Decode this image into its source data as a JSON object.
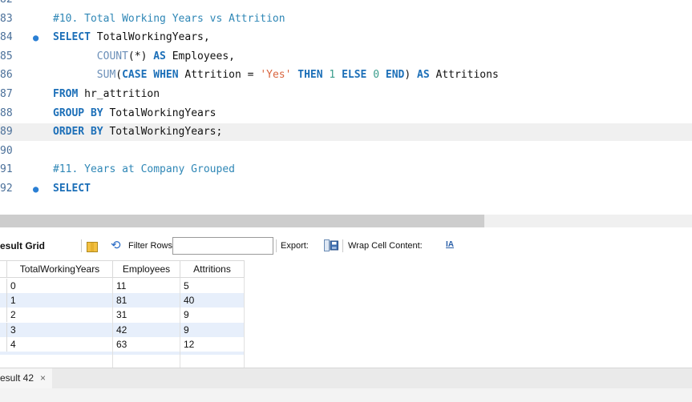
{
  "editor": {
    "lines": [
      {
        "num": "82",
        "dot": false,
        "current": false,
        "tokens": []
      },
      {
        "num": "83",
        "dot": false,
        "current": false,
        "tokens": [
          {
            "t": "#10. Total Working Years vs Attrition",
            "c": "cm"
          }
        ]
      },
      {
        "num": "84",
        "dot": true,
        "current": false,
        "tokens": [
          {
            "t": "SELECT",
            "c": "kw"
          },
          {
            "t": " TotalWorkingYears,",
            "c": "id"
          }
        ]
      },
      {
        "num": "85",
        "dot": false,
        "current": false,
        "tokens": [
          {
            "t": "       COUNT",
            "c": "fn"
          },
          {
            "t": "(*) ",
            "c": "id"
          },
          {
            "t": "AS",
            "c": "kw"
          },
          {
            "t": " Employees,",
            "c": "id"
          }
        ]
      },
      {
        "num": "86",
        "dot": false,
        "current": false,
        "tokens": [
          {
            "t": "       SUM",
            "c": "fn"
          },
          {
            "t": "(",
            "c": "id"
          },
          {
            "t": "CASE WHEN",
            "c": "kw"
          },
          {
            "t": " Attrition = ",
            "c": "id"
          },
          {
            "t": "'Yes'",
            "c": "str"
          },
          {
            "t": " ",
            "c": "id"
          },
          {
            "t": "THEN",
            "c": "kw"
          },
          {
            "t": " ",
            "c": "id"
          },
          {
            "t": "1",
            "c": "num"
          },
          {
            "t": " ",
            "c": "id"
          },
          {
            "t": "ELSE",
            "c": "kw"
          },
          {
            "t": " ",
            "c": "id"
          },
          {
            "t": "0",
            "c": "num"
          },
          {
            "t": " ",
            "c": "id"
          },
          {
            "t": "END",
            "c": "kw"
          },
          {
            "t": ") ",
            "c": "id"
          },
          {
            "t": "AS",
            "c": "kw"
          },
          {
            "t": " Attritions",
            "c": "id"
          }
        ]
      },
      {
        "num": "87",
        "dot": false,
        "current": false,
        "tokens": [
          {
            "t": "FROM",
            "c": "kw"
          },
          {
            "t": " hr_attrition",
            "c": "id"
          }
        ]
      },
      {
        "num": "88",
        "dot": false,
        "current": false,
        "tokens": [
          {
            "t": "GROUP BY",
            "c": "kw"
          },
          {
            "t": " TotalWorkingYears",
            "c": "id"
          }
        ]
      },
      {
        "num": "89",
        "dot": false,
        "current": true,
        "tokens": [
          {
            "t": "ORDER BY",
            "c": "kw"
          },
          {
            "t": " TotalWorkingYears;",
            "c": "id"
          }
        ]
      },
      {
        "num": "90",
        "dot": false,
        "current": false,
        "tokens": []
      },
      {
        "num": "91",
        "dot": false,
        "current": false,
        "tokens": [
          {
            "t": "#11. Years at Company Grouped",
            "c": "cm"
          }
        ]
      },
      {
        "num": "92",
        "dot": true,
        "current": false,
        "tokens": [
          {
            "t": "SELECT",
            "c": "kw"
          }
        ]
      }
    ]
  },
  "toolbar": {
    "result_grid_label": "esult Grid",
    "filter_label": "Filter Rows:",
    "filter_value": "",
    "export_label": "Export:",
    "wrap_label": "Wrap Cell Content:",
    "wrap_icon_text": "IA"
  },
  "grid": {
    "columns": [
      "TotalWorkingYears",
      "Employees",
      "Attritions"
    ],
    "rows": [
      [
        "0",
        "11",
        "5"
      ],
      [
        "1",
        "81",
        "40"
      ],
      [
        "2",
        "31",
        "9"
      ],
      [
        "3",
        "42",
        "9"
      ],
      [
        "4",
        "63",
        "12"
      ]
    ]
  },
  "tabs": {
    "active_label": "esult 42",
    "close_glyph": "×"
  },
  "colors": {
    "keyword": "#1c6fb8",
    "comment": "#2f87b6",
    "string": "#d9653f",
    "number": "#3a9d8c",
    "alt_row": "#e7effb"
  }
}
